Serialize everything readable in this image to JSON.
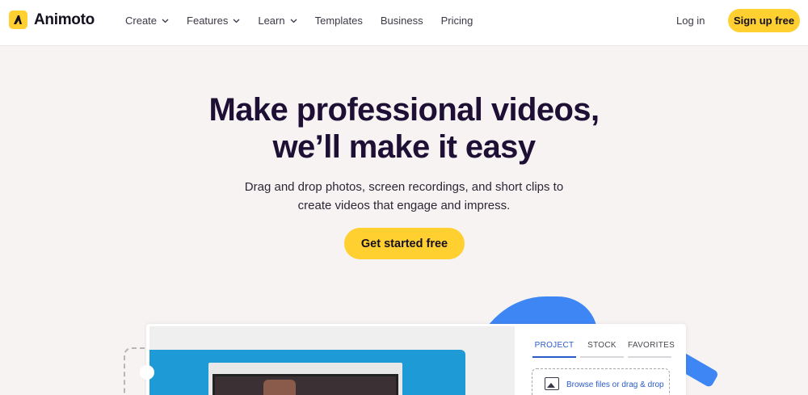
{
  "brand": {
    "name": "Animoto",
    "accent": "#ffd02f",
    "link": "#2a5bc8",
    "decor_blue": "#3f86f5"
  },
  "nav": {
    "items": [
      {
        "label": "Create",
        "dropdown": true
      },
      {
        "label": "Features",
        "dropdown": true
      },
      {
        "label": "Learn",
        "dropdown": true
      },
      {
        "label": "Templates",
        "dropdown": false
      },
      {
        "label": "Business",
        "dropdown": false
      },
      {
        "label": "Pricing",
        "dropdown": false
      }
    ],
    "login": "Log in",
    "signup": "Sign up free"
  },
  "hero": {
    "headline_line1": "Make professional videos,",
    "headline_line2": "we’ll make it easy",
    "sub_line1": "Drag and drop photos, screen recordings, and short clips to",
    "sub_line2": "create videos that engage and impress.",
    "cta": "Get started free"
  },
  "editor": {
    "tabs": [
      "PROJECT",
      "STOCK",
      "FAVORITES"
    ],
    "active_tab": "PROJECT",
    "dropzone_text": "Browse files or drag & drop"
  }
}
